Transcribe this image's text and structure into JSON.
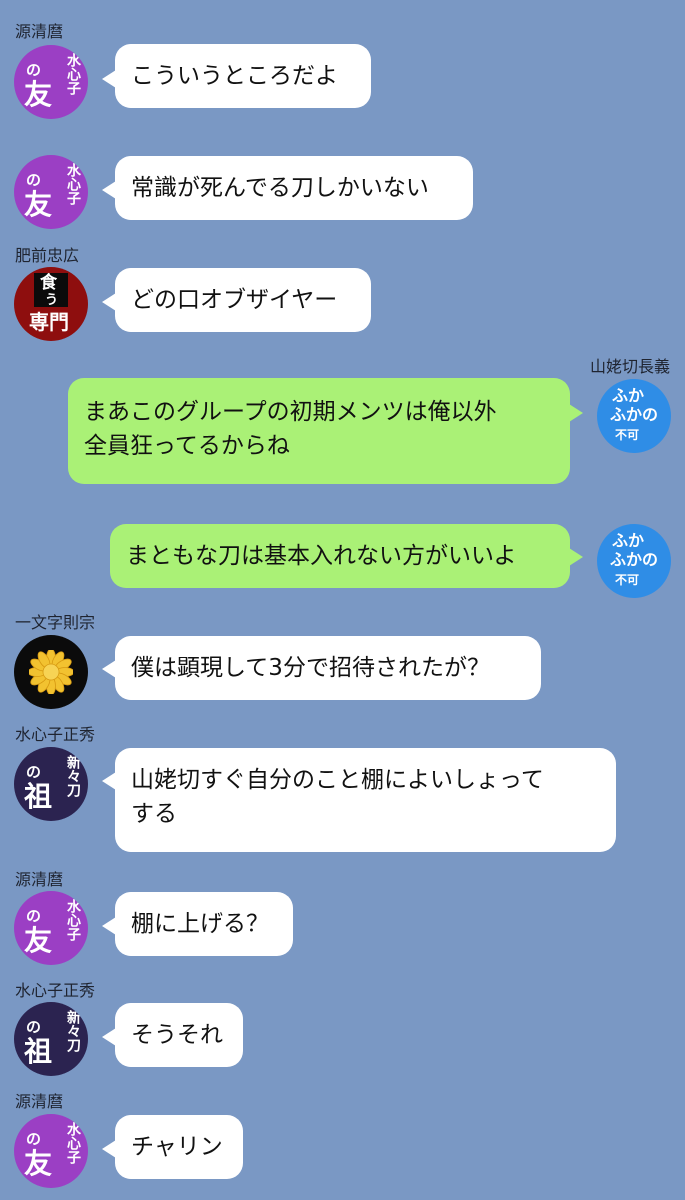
{
  "colors": {
    "background": "#7a98c4",
    "incoming_bubble": "#ffffff",
    "outgoing_bubble": "#aaf176"
  },
  "messages": [
    {
      "sender": "源清麿",
      "text": "こういうところだよ",
      "avatar": "purple-mizugokoro-icon",
      "direction": "incoming"
    },
    {
      "sender": "",
      "text": "常識が死んでる刀しかいない",
      "avatar": "purple-mizugokoro-icon",
      "direction": "incoming"
    },
    {
      "sender": "肥前忠広",
      "text": "どの口オブザイヤー",
      "avatar": "shoku-senmon-icon",
      "direction": "incoming"
    },
    {
      "sender": "山姥切長義",
      "text": "まあこのグループの初期メンツは俺以外\n全員狂ってるからね",
      "avatar": "blue-fukafuka-icon",
      "direction": "outgoing"
    },
    {
      "sender": "",
      "text": "まともな刀は基本入れない方がいいよ",
      "avatar": "blue-fukafuka-icon",
      "direction": "outgoing"
    },
    {
      "sender": "一文字則宗",
      "text": "僕は顕現して3分で招待されたが？",
      "avatar": "chrysanthemum-icon",
      "direction": "incoming"
    },
    {
      "sender": "水心子正秀",
      "text": "山姥切すぐ自分のこと棚によいしょって\nする",
      "avatar": "navy-shinshinto-icon",
      "direction": "incoming"
    },
    {
      "sender": "源清麿",
      "text": "棚に上げる？",
      "avatar": "purple-mizugokoro-icon",
      "direction": "incoming"
    },
    {
      "sender": "水心子正秀",
      "text": "そうそれ",
      "avatar": "navy-shinshinto-icon",
      "direction": "incoming"
    },
    {
      "sender": "源清麿",
      "text": "チャリン",
      "avatar": "purple-mizugokoro-icon",
      "direction": "incoming"
    }
  ],
  "avatars": {
    "purple": {
      "no": "の",
      "tomo": "友",
      "line": "水心子"
    },
    "navy": {
      "no": "の",
      "so": "祖",
      "line": "新々刀"
    },
    "red": {
      "top": "食",
      "mid": "う",
      "bottom": "専門"
    },
    "blue": {
      "a": "ふか",
      "b": "ふかの",
      "c": "不可"
    }
  }
}
